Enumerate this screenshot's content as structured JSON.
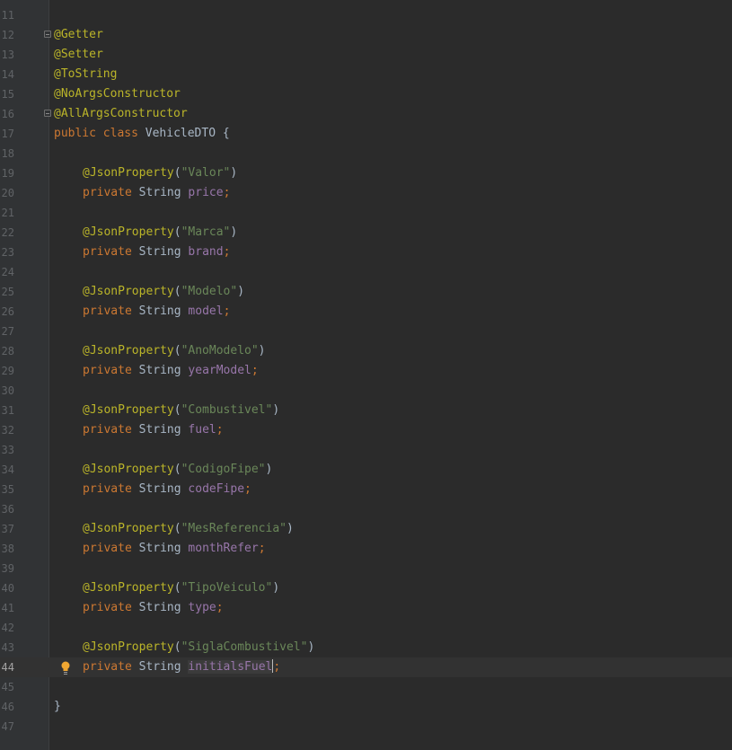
{
  "editor": {
    "lines": [
      {
        "num": "11"
      },
      {
        "num": "12",
        "fold": true,
        "annotation": "@Getter"
      },
      {
        "num": "13",
        "annotation": "@Setter"
      },
      {
        "num": "14",
        "annotation": "@ToString"
      },
      {
        "num": "15",
        "annotation": "@NoArgsConstructor"
      },
      {
        "num": "16",
        "fold": true,
        "annotation": "@AllArgsConstructor"
      },
      {
        "num": "17",
        "class_decl": {
          "kw1": "public",
          "kw2": "class",
          "name": "VehicleDTO",
          "brace": "{"
        }
      },
      {
        "num": "18"
      },
      {
        "num": "19",
        "json": {
          "annot": "@JsonProperty",
          "open": "(",
          "value": "\"Valor\"",
          "close": ")"
        }
      },
      {
        "num": "20",
        "field": {
          "kw": "private",
          "type": "String",
          "name": "price",
          "semi": ";"
        }
      },
      {
        "num": "21"
      },
      {
        "num": "22",
        "json": {
          "annot": "@JsonProperty",
          "open": "(",
          "value": "\"Marca\"",
          "close": ")"
        }
      },
      {
        "num": "23",
        "field": {
          "kw": "private",
          "type": "String",
          "name": "brand",
          "semi": ";"
        }
      },
      {
        "num": "24"
      },
      {
        "num": "25",
        "json": {
          "annot": "@JsonProperty",
          "open": "(",
          "value": "\"Modelo\"",
          "close": ")"
        }
      },
      {
        "num": "26",
        "field": {
          "kw": "private",
          "type": "String",
          "name": "model",
          "semi": ";"
        }
      },
      {
        "num": "27"
      },
      {
        "num": "28",
        "json": {
          "annot": "@JsonProperty",
          "open": "(",
          "value": "\"AnoModelo\"",
          "close": ")"
        }
      },
      {
        "num": "29",
        "field": {
          "kw": "private",
          "type": "String",
          "name": "yearModel",
          "semi": ";"
        }
      },
      {
        "num": "30"
      },
      {
        "num": "31",
        "json": {
          "annot": "@JsonProperty",
          "open": "(",
          "value": "\"Combustivel\"",
          "close": ")"
        }
      },
      {
        "num": "32",
        "field": {
          "kw": "private",
          "type": "String",
          "name": "fuel",
          "semi": ";"
        }
      },
      {
        "num": "33"
      },
      {
        "num": "34",
        "json": {
          "annot": "@JsonProperty",
          "open": "(",
          "value": "\"CodigoFipe\"",
          "close": ")"
        }
      },
      {
        "num": "35",
        "field": {
          "kw": "private",
          "type": "String",
          "name": "codeFipe",
          "semi": ";"
        }
      },
      {
        "num": "36"
      },
      {
        "num": "37",
        "json": {
          "annot": "@JsonProperty",
          "open": "(",
          "value": "\"MesReferencia\"",
          "close": ")"
        }
      },
      {
        "num": "38",
        "field": {
          "kw": "private",
          "type": "String",
          "name": "monthRefer",
          "semi": ";"
        }
      },
      {
        "num": "39"
      },
      {
        "num": "40",
        "json": {
          "annot": "@JsonProperty",
          "open": "(",
          "value": "\"TipoVeiculo\"",
          "close": ")"
        }
      },
      {
        "num": "41",
        "field": {
          "kw": "private",
          "type": "String",
          "name": "type",
          "semi": ";"
        }
      },
      {
        "num": "42"
      },
      {
        "num": "43",
        "json": {
          "annot": "@JsonProperty",
          "open": "(",
          "value": "\"SiglaCombustivel\"",
          "close": ")"
        }
      },
      {
        "num": "44",
        "current": true,
        "bulb": true,
        "field": {
          "kw": "private",
          "type": "String",
          "name": "initialsFuel",
          "semi": ";"
        }
      },
      {
        "num": "45"
      },
      {
        "num": "46",
        "brace": "}"
      },
      {
        "num": "47"
      }
    ]
  },
  "colors": {
    "background": "#2b2b2b",
    "gutter": "#313335",
    "annotation": "#bbb529",
    "keyword": "#cc7832",
    "string": "#6a8759",
    "field": "#9876aa",
    "text": "#a9b7c6",
    "current_line": "#323232"
  },
  "icons": {
    "fold_marker": "fold-marker-icon",
    "intention": "lightbulb-icon"
  }
}
